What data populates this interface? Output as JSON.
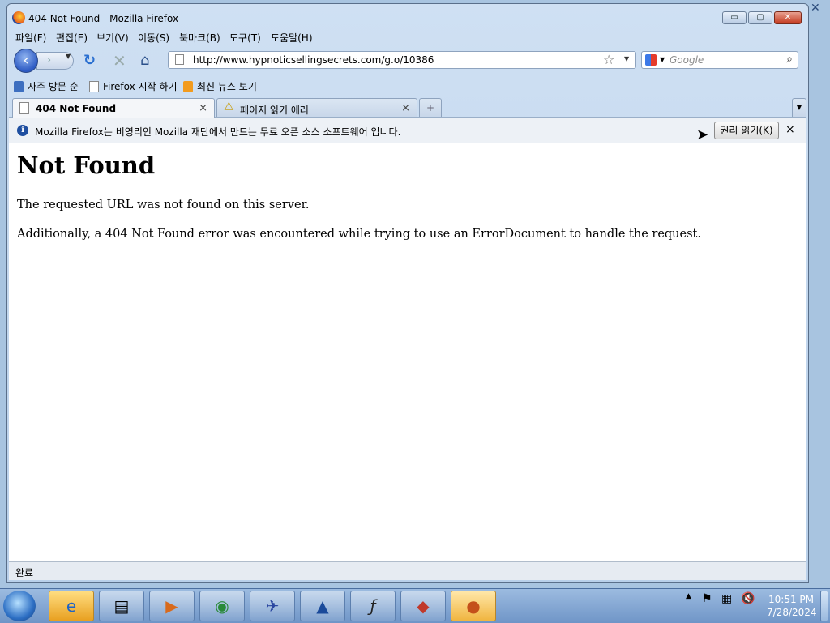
{
  "window": {
    "title": "404 Not Found - Mozilla Firefox",
    "min_label": "▭",
    "max_label": "▢",
    "close_label": "✕"
  },
  "menu": [
    "파일(F)",
    "편집(E)",
    "보기(V)",
    "이동(S)",
    "북마크(B)",
    "도구(T)",
    "도움말(H)"
  ],
  "nav": {
    "url": "http://www.hypnoticsellingsecrets.com/g.o/10386",
    "search_placeholder": "Google"
  },
  "bookmarks": [
    "자주 방문 순",
    "Firefox 시작 하기",
    "최신 뉴스 보기"
  ],
  "tabs": [
    {
      "label": "404 Not Found",
      "close": "×"
    },
    {
      "label": "페이지 읽기 에러",
      "close": "×"
    }
  ],
  "notification": {
    "text": "Mozilla Firefox는 비영리인 Mozilla 재단에서 만드는 무료 오픈 소스 소프트웨어 입니다.",
    "button": "권리 읽기(K)",
    "close": "×"
  },
  "page": {
    "heading": "Not Found",
    "p1": "The requested URL was not found on this server.",
    "p2": "Additionally, a 404 Not Found error was encountered while trying to use an ErrorDocument to handle the request."
  },
  "status": {
    "text": "완료"
  },
  "taskbar": {
    "items": [
      "internet-explorer",
      "file-explorer",
      "media-player",
      "network-app",
      "jet-app",
      "rocket-app",
      "flash-app",
      "media-app",
      "firefox"
    ],
    "active_item": "firefox"
  },
  "clock": {
    "time": "10:51 PM",
    "date": "7/28/2024"
  },
  "colors": {
    "accent": "#2e5bc4",
    "title_gradient_top": "#cfe0f3",
    "taskbar_top": "#9cbbe0"
  }
}
